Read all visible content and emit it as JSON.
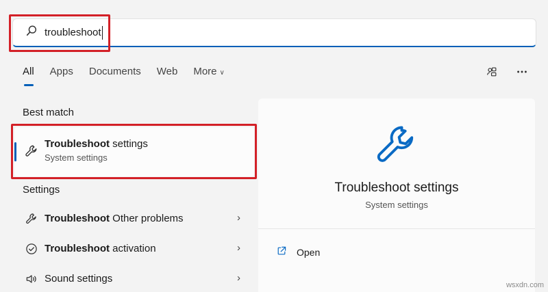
{
  "search": {
    "value": "troubleshoot",
    "icon": "search-icon"
  },
  "tabs": [
    {
      "label": "All",
      "active": true
    },
    {
      "label": "Apps"
    },
    {
      "label": "Documents"
    },
    {
      "label": "Web"
    },
    {
      "label": "More"
    }
  ],
  "best_match": {
    "heading": "Best match",
    "title_bold": "Troubleshoot",
    "title_rest": " settings",
    "subtitle": "System settings",
    "icon": "wrench-icon"
  },
  "settings": {
    "heading": "Settings",
    "items": [
      {
        "bold": "Troubleshoot",
        "rest": " Other problems",
        "icon": "wrench-icon"
      },
      {
        "bold": "Troubleshoot",
        "rest": " activation",
        "icon": "check-circle-icon"
      },
      {
        "bold": "",
        "rest": "Sound settings",
        "icon": "speaker-icon"
      }
    ]
  },
  "preview": {
    "title": "Troubleshoot settings",
    "subtitle": "System settings",
    "open_label": "Open",
    "icon": "wrench-icon"
  },
  "watermark": "wsxdn.com",
  "colors": {
    "accent": "#005fb8",
    "highlight": "#d32027",
    "background": "#f3f3f3"
  }
}
